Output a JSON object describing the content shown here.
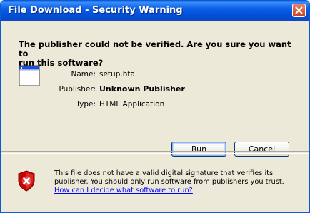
{
  "window": {
    "title": "File Download - Security Warning"
  },
  "dialog": {
    "heading_line1": "The publisher could not be verified.  Are you sure you want to",
    "heading_line2": "run this software?",
    "file_icon": "application-window-icon",
    "details": [
      {
        "label": "Name:",
        "value": "setup.hta"
      },
      {
        "label": "Publisher:",
        "value": "Unknown Publisher"
      },
      {
        "label": "Type:",
        "value": "HTML Application"
      }
    ],
    "buttons": {
      "run": "Run",
      "cancel": "Cancel"
    }
  },
  "warning": {
    "icon": "security-shield-x-icon",
    "line1": "This file does not have a valid digital signature that verifies its",
    "line2": "publisher.  You should only run software from publishers you trust.",
    "link": "How can I decide what software to run?"
  },
  "colors": {
    "titlebar": "#0054e3",
    "dialog_bg": "#ece9d8",
    "close_button": "#d4532b",
    "link": "#0000ff",
    "shield": "#c00000"
  }
}
